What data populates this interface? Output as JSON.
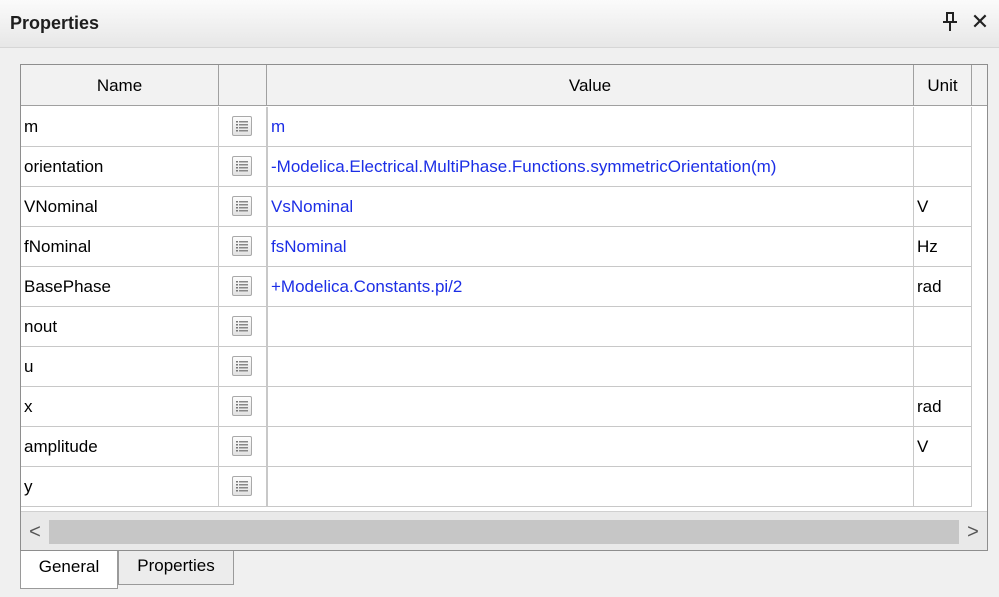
{
  "panel": {
    "title": "Properties",
    "pin_icon": "pin-icon",
    "close_label": "✕"
  },
  "table": {
    "headers": {
      "name": "Name",
      "button": "",
      "value": "Value",
      "unit": "Unit"
    },
    "rows": [
      {
        "name": "m",
        "value": "m",
        "unit": ""
      },
      {
        "name": "orientation",
        "value": "-Modelica.Electrical.MultiPhase.Functions.symmetricOrientation(m)",
        "unit": ""
      },
      {
        "name": "VNominal",
        "value": "VsNominal",
        "unit": "V"
      },
      {
        "name": "fNominal",
        "value": "fsNominal",
        "unit": "Hz"
      },
      {
        "name": "BasePhase",
        "value": "+Modelica.Constants.pi/2",
        "unit": "rad"
      },
      {
        "name": "nout",
        "value": "",
        "unit": ""
      },
      {
        "name": "u",
        "value": "",
        "unit": ""
      },
      {
        "name": "x",
        "value": "",
        "unit": "rad"
      },
      {
        "name": "amplitude",
        "value": "",
        "unit": "V"
      },
      {
        "name": "y",
        "value": "",
        "unit": ""
      }
    ],
    "value_color": "#1c2ee6"
  },
  "scrollbar": {
    "left_arrow": "<",
    "right_arrow": ">"
  },
  "tabs": [
    {
      "label": "General",
      "active": true
    },
    {
      "label": "Properties",
      "active": false
    }
  ]
}
